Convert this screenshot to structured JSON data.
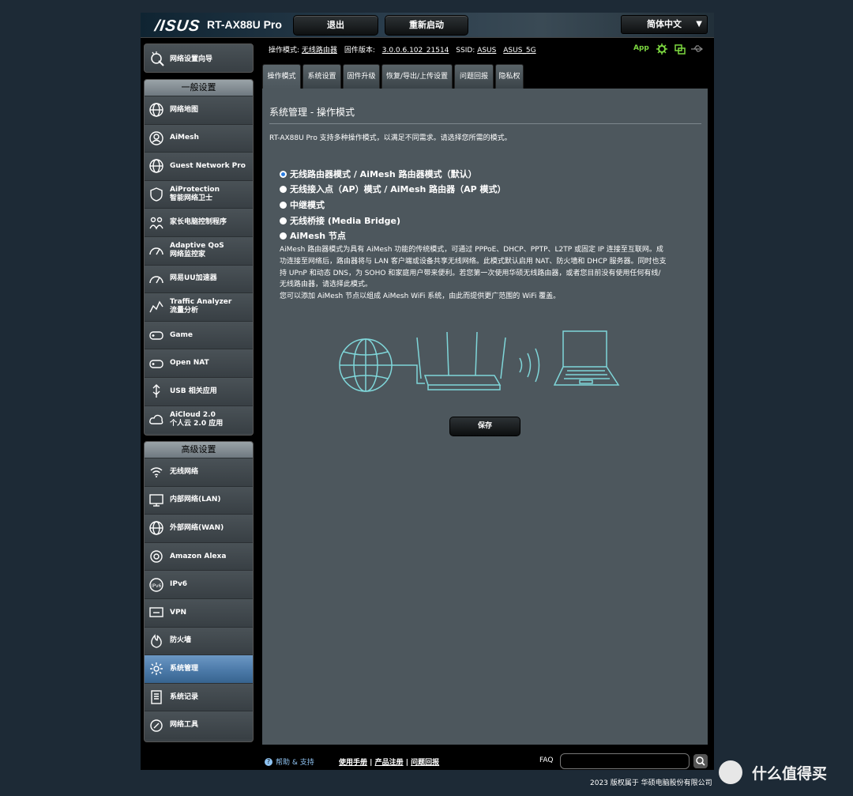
{
  "header": {
    "logo": "/ISUS",
    "model": "RT-AX88U Pro",
    "logout_label": "退出",
    "reboot_label": "重新启动",
    "language": "简体中文"
  },
  "sidebar": {
    "wizard_label": "网络设置向导",
    "general": {
      "title": "一般设置",
      "items": [
        {
          "l1": "网络地图",
          "l2": ""
        },
        {
          "l1": "AiMesh",
          "l2": ""
        },
        {
          "l1": "Guest Network Pro",
          "l2": ""
        },
        {
          "l1": "AiProtection",
          "l2": "智能网络卫士"
        },
        {
          "l1": "家长电脑控制程序",
          "l2": ""
        },
        {
          "l1": "Adaptive QoS",
          "l2": "网络监控家"
        },
        {
          "l1": "网易UU加速器",
          "l2": ""
        },
        {
          "l1": "Traffic Analyzer",
          "l2": "流量分析"
        },
        {
          "l1": "Game",
          "l2": ""
        },
        {
          "l1": "Open NAT",
          "l2": ""
        },
        {
          "l1": "USB 相关应用",
          "l2": ""
        },
        {
          "l1": "AiCloud 2.0",
          "l2": "个人云 2.0 应用"
        }
      ]
    },
    "advanced": {
      "title": "高级设置",
      "items": [
        {
          "l1": "无线网络"
        },
        {
          "l1": "内部网络(LAN)"
        },
        {
          "l1": "外部网络(WAN)"
        },
        {
          "l1": "Amazon Alexa"
        },
        {
          "l1": "IPv6"
        },
        {
          "l1": "VPN"
        },
        {
          "l1": "防火墙"
        },
        {
          "l1": "系统管理"
        },
        {
          "l1": "系统记录"
        },
        {
          "l1": "网络工具"
        }
      ]
    }
  },
  "status": {
    "mode_label": "操作模式:",
    "mode_value": "无线路由器",
    "fw_label": "固件版本:",
    "fw_value": "3.0.0.6.102_21514",
    "ssid_label": "SSID:",
    "ssid_1": "ASUS",
    "ssid_2": "ASUS_5G",
    "app_label": "App"
  },
  "tabs": [
    "操作模式",
    "系统设置",
    "固件升级",
    "恢复/导出/上传设置",
    "问题回报",
    "隐私权"
  ],
  "panel": {
    "title": "系统管理 - 操作模式",
    "description": "RT-AX88U Pro 支持多种操作模式，以满足不同需求。请选择您所需的模式。",
    "modes": [
      "无线路由器模式 / AiMesh 路由器模式（默认）",
      "无线接入点（AP）模式 / AiMesh 路由器（AP 模式）",
      "中继模式",
      "无线桥接 (Media Bridge)",
      "AiMesh 节点"
    ],
    "mode_desc_lines": [
      "AiMesh 路由器模式为具有 AiMesh 功能的传统模式，可通过 PPPoE、DHCP、PPTP、L2TP 或固定 IP 连接至互联网。成",
      "功连接至网络后，路由器将与 LAN 客户端或设备共享无线网络。此模式默认启用 NAT、防火墙和 DHCP 服务器。同时也支",
      "持 UPnP 和动态 DNS，为 SOHO 和家庭用户带来便利。若您第一次使用华硕无线路由器，或者您目前没有使用任何有线/",
      "无线路由器，请选择此模式。",
      "您可以添加 AiMesh 节点以组成 AiMesh WiFi 系统，由此而提供更广范围的 WiFi 覆盖。"
    ],
    "save_label": "保存"
  },
  "footer": {
    "help": "帮助 & 支持",
    "link1": "使用手册",
    "link2": "产品注册",
    "link3": "问题回报",
    "faq": "FAQ",
    "copyright": "2023 版权属于 华硕电脑股份有限公司"
  },
  "watermark": {
    "text": "什么值得买"
  },
  "colors": {
    "accent_green": "#7dd940",
    "active_blue": "#4e7cab",
    "link_blue": "#8fc3f2"
  }
}
